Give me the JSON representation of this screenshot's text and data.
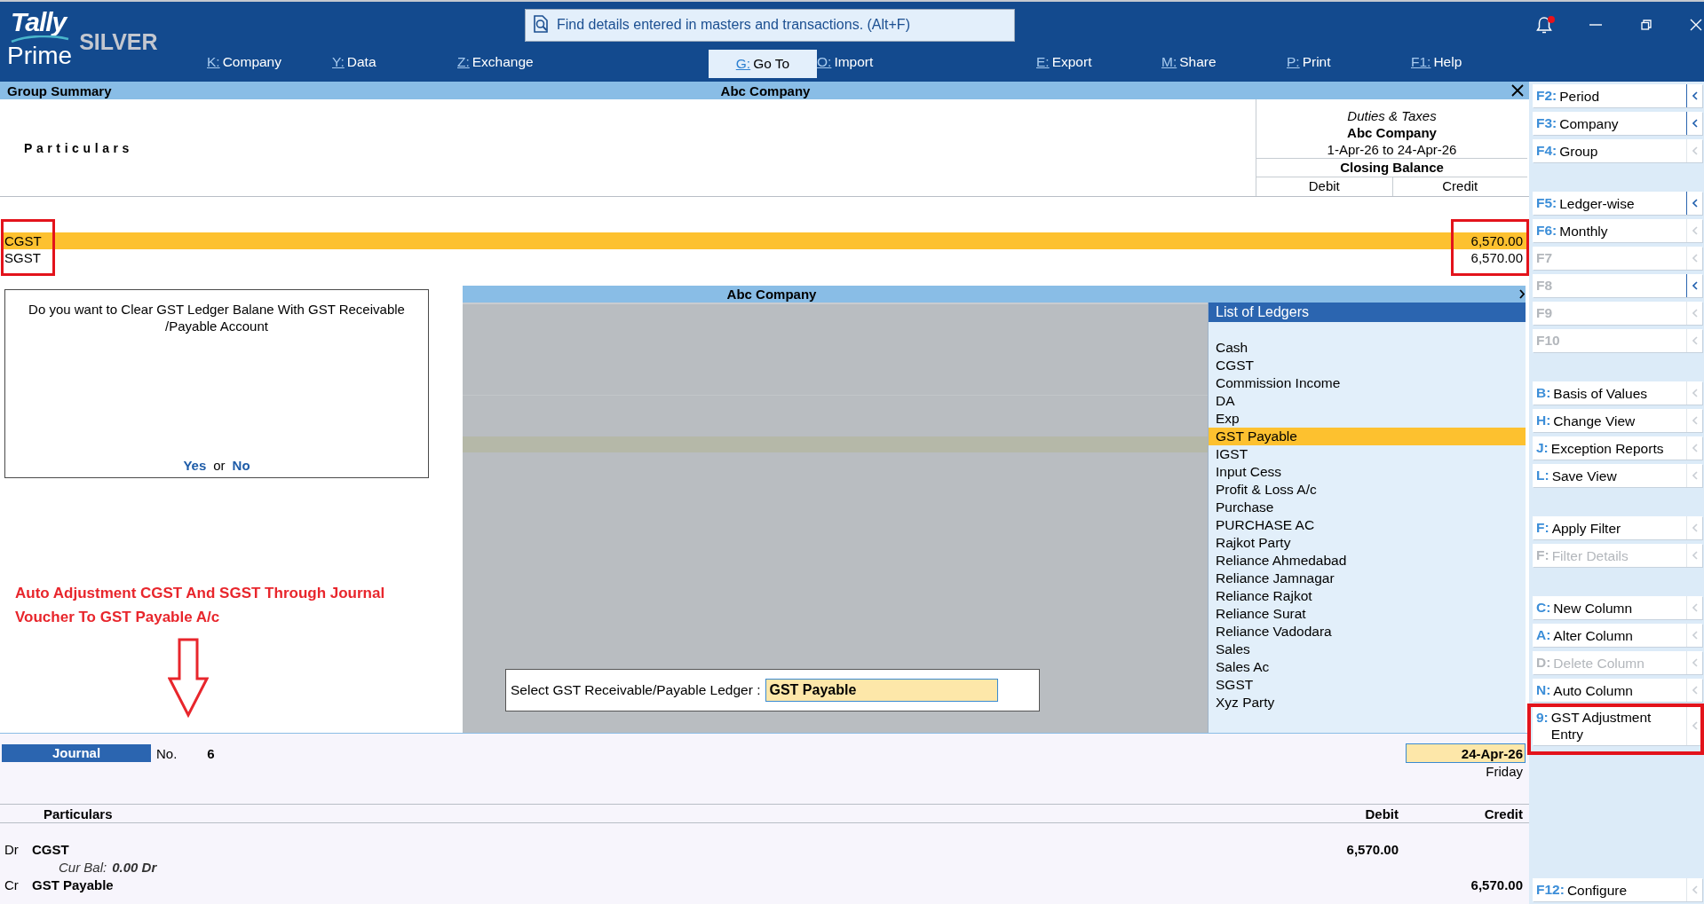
{
  "logo": {
    "brand": "Tally",
    "product": "Prime",
    "edition": "SILVER"
  },
  "search": {
    "placeholder": "Find details entered in masters and transactions. (Alt+F)"
  },
  "notifications": {
    "unread": true
  },
  "menu": [
    {
      "key": "K:",
      "label": "Company",
      "selected": false
    },
    {
      "key": "Y:",
      "label": "Data",
      "selected": false
    },
    {
      "key": "Z:",
      "label": "Exchange",
      "selected": false
    },
    {
      "key": "G:",
      "label": "Go To",
      "selected": true
    },
    {
      "key": "O:",
      "label": "Import",
      "selected": false
    },
    {
      "key": "E:",
      "label": "Export",
      "selected": false
    },
    {
      "key": "M:",
      "label": "Share",
      "selected": false
    },
    {
      "key": "P:",
      "label": "Print",
      "selected": false
    },
    {
      "key": "F1:",
      "label": "Help",
      "selected": false
    }
  ],
  "report": {
    "title": "Group Summary",
    "company": "Abc Company",
    "particulars_header": "Particulars",
    "group": "Duties & Taxes",
    "group_company": "Abc Company",
    "period": "1-Apr-26 to 24-Apr-26",
    "balance_header": "Closing Balance",
    "debit_header": "Debit",
    "credit_header": "Credit",
    "outlined": true,
    "rows": [
      {
        "name": "CGST",
        "credit": "6,570.00",
        "selected": true
      },
      {
        "name": "SGST",
        "credit": "6,570.00",
        "selected": false
      }
    ]
  },
  "dialog": {
    "message": "Do you want to Clear GST Ledger Balane With GST Receivable /Payable Account",
    "yes": "Yes",
    "or": "or",
    "no": "No"
  },
  "annotations": [
    {
      "kind": "note",
      "text": "Auto Adjustment CGST And SGST Through Journal Voucher To GST Payable A/c"
    },
    {
      "kind": "arrow"
    }
  ],
  "ledger_panel": {
    "title": "Abc Company",
    "prompt": "Select GST Receivable/Payable Ledger :",
    "value": "GST Payable",
    "list_title": "List of Ledgers",
    "items": [
      {
        "label": "Cash",
        "selected": false
      },
      {
        "label": "CGST",
        "selected": false
      },
      {
        "label": "Commission Income",
        "selected": false
      },
      {
        "label": "DA",
        "selected": false
      },
      {
        "label": "Exp",
        "selected": false
      },
      {
        "label": "GST Payable",
        "selected": true
      },
      {
        "label": "IGST",
        "selected": false
      },
      {
        "label": "Input Cess",
        "selected": false
      },
      {
        "label": "Profit & Loss A/c",
        "selected": false
      },
      {
        "label": "Purchase",
        "selected": false
      },
      {
        "label": "PURCHASE AC",
        "selected": false
      },
      {
        "label": "Rajkot Party",
        "selected": false
      },
      {
        "label": "Reliance Ahmedabad",
        "selected": false
      },
      {
        "label": "Reliance Jamnagar",
        "selected": false
      },
      {
        "label": "Reliance Rajkot",
        "selected": false
      },
      {
        "label": "Reliance Surat",
        "selected": false
      },
      {
        "label": "Reliance Vadodara",
        "selected": false
      },
      {
        "label": "Sales",
        "selected": false
      },
      {
        "label": "Sales Ac",
        "selected": false
      },
      {
        "label": "SGST",
        "selected": false
      },
      {
        "label": "Xyz Party",
        "selected": false
      }
    ]
  },
  "voucher": {
    "type": "Journal",
    "number_label": "No.",
    "number": "6",
    "date": "24-Apr-26",
    "day": "Friday",
    "particulars_header": "Particulars",
    "debit_header": "Debit",
    "credit_header": "Credit",
    "entries": [
      {
        "side": "Dr",
        "ledger": "CGST",
        "debit": "6,570.00",
        "balance_label": "Cur Bal:",
        "balance": "0.00 Dr"
      },
      {
        "side": "Cr",
        "ledger": "GST Payable",
        "credit": "6,570.00"
      }
    ]
  },
  "sidebar": {
    "groups": [
      [
        {
          "key": "F2:",
          "label": "Period",
          "disabled": false,
          "arrow_active": true,
          "outlined": false
        },
        {
          "key": "F3:",
          "label": "Company",
          "disabled": false,
          "arrow_active": true,
          "outlined": false
        },
        {
          "key": "F4:",
          "label": "Group",
          "disabled": false,
          "arrow_active": false,
          "outlined": false
        }
      ],
      [
        {
          "key": "F5:",
          "label": "Ledger-wise",
          "disabled": false,
          "arrow_active": true,
          "outlined": false
        },
        {
          "key": "F6:",
          "label": "Monthly",
          "disabled": false,
          "arrow_active": false,
          "outlined": false
        },
        {
          "key": "F7",
          "disabled": true,
          "arrow_active": false,
          "outlined": false
        },
        {
          "key": "F8",
          "disabled": true,
          "arrow_active": true,
          "outlined": false
        },
        {
          "key": "F9",
          "disabled": true,
          "arrow_active": false,
          "outlined": false
        },
        {
          "key": "F10",
          "disabled": true,
          "arrow_active": false,
          "outlined": false
        }
      ],
      [
        {
          "key": "B:",
          "label": "Basis of Values",
          "disabled": false,
          "arrow_active": false,
          "outlined": false
        },
        {
          "key": "H:",
          "label": "Change View",
          "disabled": false,
          "arrow_active": false,
          "outlined": false
        },
        {
          "key": "J:",
          "label": "Exception Reports",
          "disabled": false,
          "arrow_active": false,
          "outlined": false
        },
        {
          "key": "L:",
          "label": "Save View",
          "disabled": false,
          "arrow_active": false,
          "outlined": false
        }
      ],
      [
        {
          "key": "F:",
          "label": "Apply Filter",
          "disabled": false,
          "arrow_active": false,
          "outlined": false
        },
        {
          "key": "F:",
          "label": "Filter Details",
          "disabled": true,
          "arrow_active": false,
          "outlined": false
        }
      ],
      [
        {
          "key": "C:",
          "label": "New Column",
          "disabled": false,
          "arrow_active": false,
          "outlined": false
        },
        {
          "key": "A:",
          "label": "Alter Column",
          "disabled": false,
          "arrow_active": false,
          "outlined": false
        },
        {
          "key": "D:",
          "label": "Delete Column",
          "disabled": true,
          "arrow_active": false,
          "outlined": false
        },
        {
          "key": "N:",
          "label": "Auto Column",
          "disabled": false,
          "arrow_active": false,
          "outlined": false
        },
        {
          "key": "9:",
          "label": "GST Adjustment Entry",
          "disabled": false,
          "arrow_active": false,
          "outlined": true
        }
      ]
    ],
    "footer": [
      {
        "key": "F12:",
        "label": "Configure",
        "disabled": false,
        "arrow_active": false,
        "outlined": false
      }
    ]
  }
}
